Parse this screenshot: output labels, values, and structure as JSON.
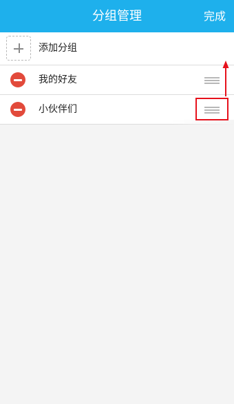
{
  "header": {
    "title": "分组管理",
    "done_label": "完成",
    "bg_color": "#1eb0ec"
  },
  "list": {
    "add_item": {
      "label": "添加分组",
      "icon": "plus-icon"
    },
    "groups": [
      {
        "label": "我的好友",
        "delete_icon": "minus-circle-icon",
        "handle_icon": "drag-handle-icon"
      },
      {
        "label": "小伙伴们",
        "delete_icon": "minus-circle-icon",
        "handle_icon": "drag-handle-icon"
      }
    ]
  },
  "annotation": {
    "highlight_color": "#e6101b",
    "arrow": "up-arrow"
  }
}
